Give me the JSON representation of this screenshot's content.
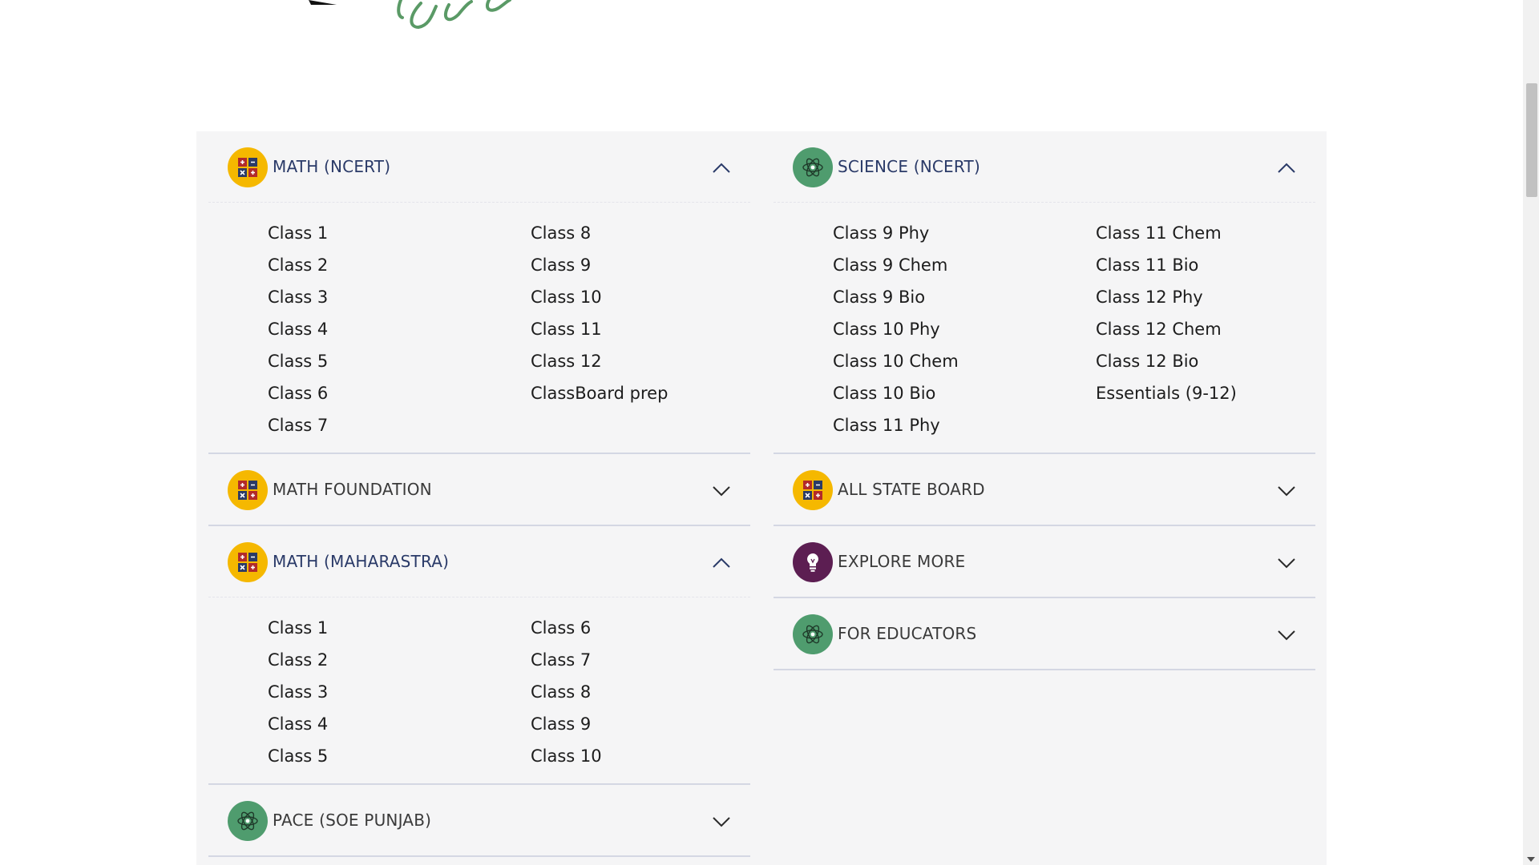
{
  "colors": {
    "panel_bg": "#f5f5f6",
    "yellow_icon": "#f5b800",
    "green_icon": "#4f9c6e",
    "purple_icon": "#5c1e52",
    "divider": "#d4d7e3"
  },
  "left_column": [
    {
      "title": "MATH (NCERT)",
      "icon": "calculator-icon",
      "state": "expanded",
      "rows": 7,
      "items": [
        "Class 1",
        "Class 2",
        "Class 3",
        "Class 4",
        "Class 5",
        "Class 6",
        "Class 7",
        "Class 8",
        "Class 9",
        "Class 10",
        "Class 11",
        "Class 12",
        "ClassBoard prep"
      ]
    },
    {
      "title": "MATH FOUNDATION",
      "icon": "calculator-icon",
      "state": "collapsed",
      "items": []
    },
    {
      "title": "MATH (MAHARASTRA)",
      "icon": "calculator-icon",
      "state": "expanded",
      "rows": 5,
      "items": [
        "Class 1",
        "Class 2",
        "Class 3",
        "Class 4",
        "Class 5",
        "Class 6",
        "Class 7",
        "Class 8",
        "Class 9",
        "Class 10"
      ]
    },
    {
      "title": "PACE (SOE PUNJAB)",
      "icon": "atom-icon",
      "state": "collapsed",
      "items": []
    }
  ],
  "right_column": [
    {
      "title": "SCIENCE (NCERT)",
      "icon": "atom-icon",
      "state": "expanded",
      "rows": 7,
      "items": [
        "Class 9 Phy",
        "Class 9 Chem",
        "Class 9 Bio",
        "Class 10 Phy",
        "Class 10 Chem",
        "Class 10 Bio",
        "Class 11 Phy",
        "Class 11 Chem",
        "Class 11 Bio",
        "Class 12 Phy",
        "Class 12 Chem",
        "Class 12 Bio",
        "Essentials (9-12)"
      ]
    },
    {
      "title": "ALL STATE BOARD",
      "icon": "calculator-icon",
      "state": "collapsed",
      "items": []
    },
    {
      "title": "EXPLORE MORE",
      "icon": "lightbulb-icon",
      "state": "collapsed",
      "items": []
    },
    {
      "title": "FOR EDUCATORS",
      "icon": "atom-icon",
      "state": "collapsed",
      "items": []
    }
  ]
}
